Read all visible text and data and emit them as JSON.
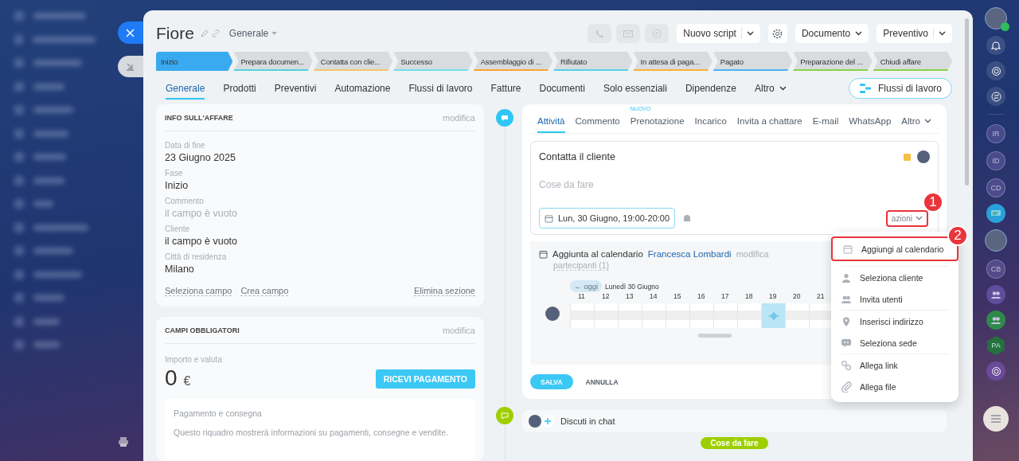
{
  "header": {
    "title": "Fiore",
    "section": "Generale",
    "actions": [
      {
        "label": "Nuovo script",
        "kind": "split"
      },
      {
        "label": "Documento",
        "kind": "dropdown"
      },
      {
        "label": "Preventivo",
        "kind": "split"
      }
    ]
  },
  "stages": [
    {
      "label": "Inizio",
      "selected": true,
      "color": "#39aaf0"
    },
    {
      "label": "Prepara documen...",
      "selected": false,
      "color": "#55d0e0"
    },
    {
      "label": "Contatta con clie...",
      "selected": false,
      "color": "#f5c66b"
    },
    {
      "label": "Successo",
      "selected": false,
      "color": "#6fdfe6"
    },
    {
      "label": "Assemblaggio di ...",
      "selected": false,
      "color": "#f9a531"
    },
    {
      "label": "Rifiutato",
      "selected": false,
      "color": "#55d0e6"
    },
    {
      "label": "In attesa di paga...",
      "selected": false,
      "color": "#f9b233"
    },
    {
      "label": "Pagato",
      "selected": false,
      "color": "#47b4f5"
    },
    {
      "label": "Preparazione del ...",
      "selected": false,
      "color": "#8cd243"
    },
    {
      "label": "Chiudi affare",
      "selected": false,
      "color": "#8cd243"
    }
  ],
  "tabs": [
    {
      "label": "Generale",
      "selected": true
    },
    {
      "label": "Prodotti",
      "selected": false
    },
    {
      "label": "Preventivi",
      "selected": false
    },
    {
      "label": "Automazione",
      "selected": false
    },
    {
      "label": "Flussi di lavoro",
      "selected": false
    },
    {
      "label": "Fatture",
      "selected": false
    },
    {
      "label": "Documenti",
      "selected": false
    },
    {
      "label": "Solo essenziali",
      "selected": false
    },
    {
      "label": "Dipendenze",
      "selected": false
    },
    {
      "label": "Altro",
      "selected": false
    }
  ],
  "workflow_button": "Flussi di lavoro",
  "deal_info": {
    "title": "INFO SULL'AFFARE",
    "edit": "modifica",
    "fields": [
      {
        "label": "Data di fine",
        "value": "23 Giugno 2025",
        "muted": false
      },
      {
        "label": "Fase",
        "value": "Inizio",
        "muted": false
      },
      {
        "label": "Commento",
        "value": "il campo è vuoto",
        "muted": true
      },
      {
        "label": "Cliente",
        "value": "il campo è vuoto",
        "muted": false
      },
      {
        "label": "Città di residenza",
        "value": "Milano",
        "muted": false
      }
    ],
    "links": [
      "Seleziona campo",
      "Crea campo"
    ],
    "delete_link": "Elimina sezione"
  },
  "required": {
    "title": "CAMPI OBBLIGATORI",
    "edit": "modifica",
    "amount_label": "Importo e valuta",
    "amount": "0",
    "currency": "€",
    "pay_button": "RICEVI PAGAMENTO",
    "box_title": "Pagamento e consegna",
    "box_text": "Questo riquadro mostrerà informazioni su pagamenti, consegne e vendite."
  },
  "activity": {
    "tabs": [
      {
        "label": "Attività",
        "selected": true
      },
      {
        "label": "Commento",
        "selected": false
      },
      {
        "label": "Prenotazione",
        "selected": false,
        "badge": "NUOVO"
      },
      {
        "label": "Incarico",
        "selected": false
      },
      {
        "label": "Invita a chattare",
        "selected": false
      },
      {
        "label": "E-mail",
        "selected": false
      },
      {
        "label": "WhatsApp",
        "selected": false
      },
      {
        "label": "Altro",
        "selected": false
      }
    ],
    "editor": {
      "title": "Contatta il cliente",
      "placeholder": "Cose da fare",
      "deadline": "Lun, 30 Giugno, 19:00-20:00",
      "actions": "azioni",
      "callout": "1"
    },
    "calendar": {
      "heading": "Aggiunta al calendario",
      "owner": "Francesca Lombardi",
      "edit": "modifica",
      "participants": "partecipanti (1)",
      "today": "← oggi",
      "date": "Lunedì 30 Giugno",
      "hours": [
        {
          "label": "11",
          "selected": false
        },
        {
          "label": "12",
          "selected": false
        },
        {
          "label": "13",
          "selected": false
        },
        {
          "label": "14",
          "selected": false
        },
        {
          "label": "15",
          "selected": false
        },
        {
          "label": "16",
          "selected": false
        },
        {
          "label": "17",
          "selected": false
        },
        {
          "label": "18",
          "selected": false
        },
        {
          "label": "19",
          "selected": true
        },
        {
          "label": "20",
          "selected": false
        },
        {
          "label": "21",
          "selected": false
        }
      ]
    },
    "save": "SALVA",
    "cancel": "ANNULLA",
    "menu": {
      "groups": [
        {
          "items": [
            {
              "label": "Aggiungi al calendario",
              "callout": "2"
            }
          ]
        },
        {
          "items": [
            {
              "label": "Seleziona cliente"
            },
            {
              "label": "Invita utenti"
            }
          ]
        },
        {
          "items": [
            {
              "label": "Inserisci indirizzo"
            },
            {
              "label": "Seleziona sede"
            }
          ]
        },
        {
          "items": [
            {
              "label": "Allega link"
            },
            {
              "label": "Allega file"
            }
          ]
        }
      ]
    }
  },
  "chat": "Discuti in chat",
  "todo_badge": "Cose da fare",
  "rail": [
    {
      "kind": "avatar"
    },
    {
      "kind": "bell"
    },
    {
      "kind": "target"
    },
    {
      "kind": "swap"
    },
    {
      "kind": "divider"
    },
    {
      "kind": "initials",
      "label": "IR"
    },
    {
      "kind": "initials",
      "label": "ID"
    },
    {
      "kind": "initials",
      "label": "CD"
    },
    {
      "kind": "chat"
    },
    {
      "kind": "avatar"
    },
    {
      "kind": "initials",
      "label": "CB"
    },
    {
      "kind": "group"
    },
    {
      "kind": "groupgreen"
    },
    {
      "kind": "hexagon",
      "label": "PA"
    },
    {
      "kind": "target"
    }
  ]
}
